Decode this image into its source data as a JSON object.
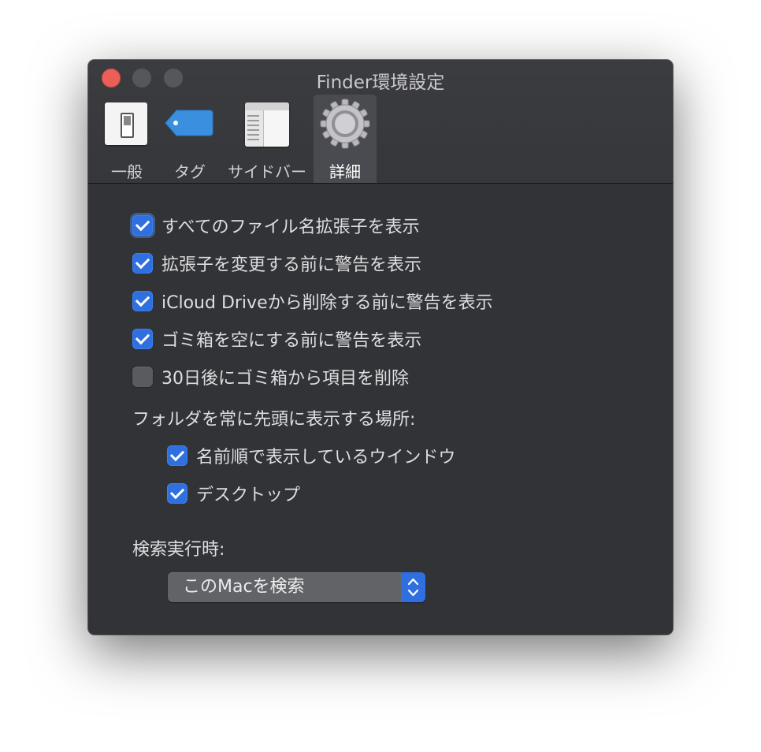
{
  "window": {
    "title": "Finder環境設定"
  },
  "toolbar": {
    "tabs": [
      {
        "label": "一般",
        "icon": "general-switch-icon"
      },
      {
        "label": "タグ",
        "icon": "tag-icon"
      },
      {
        "label": "サイドバー",
        "icon": "sidebar-icon"
      },
      {
        "label": "詳細",
        "icon": "gear-icon",
        "selected": true
      }
    ]
  },
  "advanced": {
    "options": [
      {
        "label": "すべてのファイル名拡張子を表示",
        "checked": true
      },
      {
        "label": "拡張子を変更する前に警告を表示",
        "checked": true
      },
      {
        "label": "iCloud Driveから削除する前に警告を表示",
        "checked": true
      },
      {
        "label": "ゴミ箱を空にする前に警告を表示",
        "checked": true
      },
      {
        "label": "30日後にゴミ箱から項目を削除",
        "checked": false
      }
    ],
    "folders_on_top": {
      "heading": "フォルダを常に先頭に表示する場所:",
      "options": [
        {
          "label": "名前順で表示しているウインドウ",
          "checked": true
        },
        {
          "label": "デスクトップ",
          "checked": true
        }
      ]
    },
    "search": {
      "heading": "検索実行時:",
      "selected": "このMacを検索"
    }
  },
  "colors": {
    "accent": "#2f6fdf",
    "window_bg": "#323337",
    "close_button": "#ec5f57"
  }
}
